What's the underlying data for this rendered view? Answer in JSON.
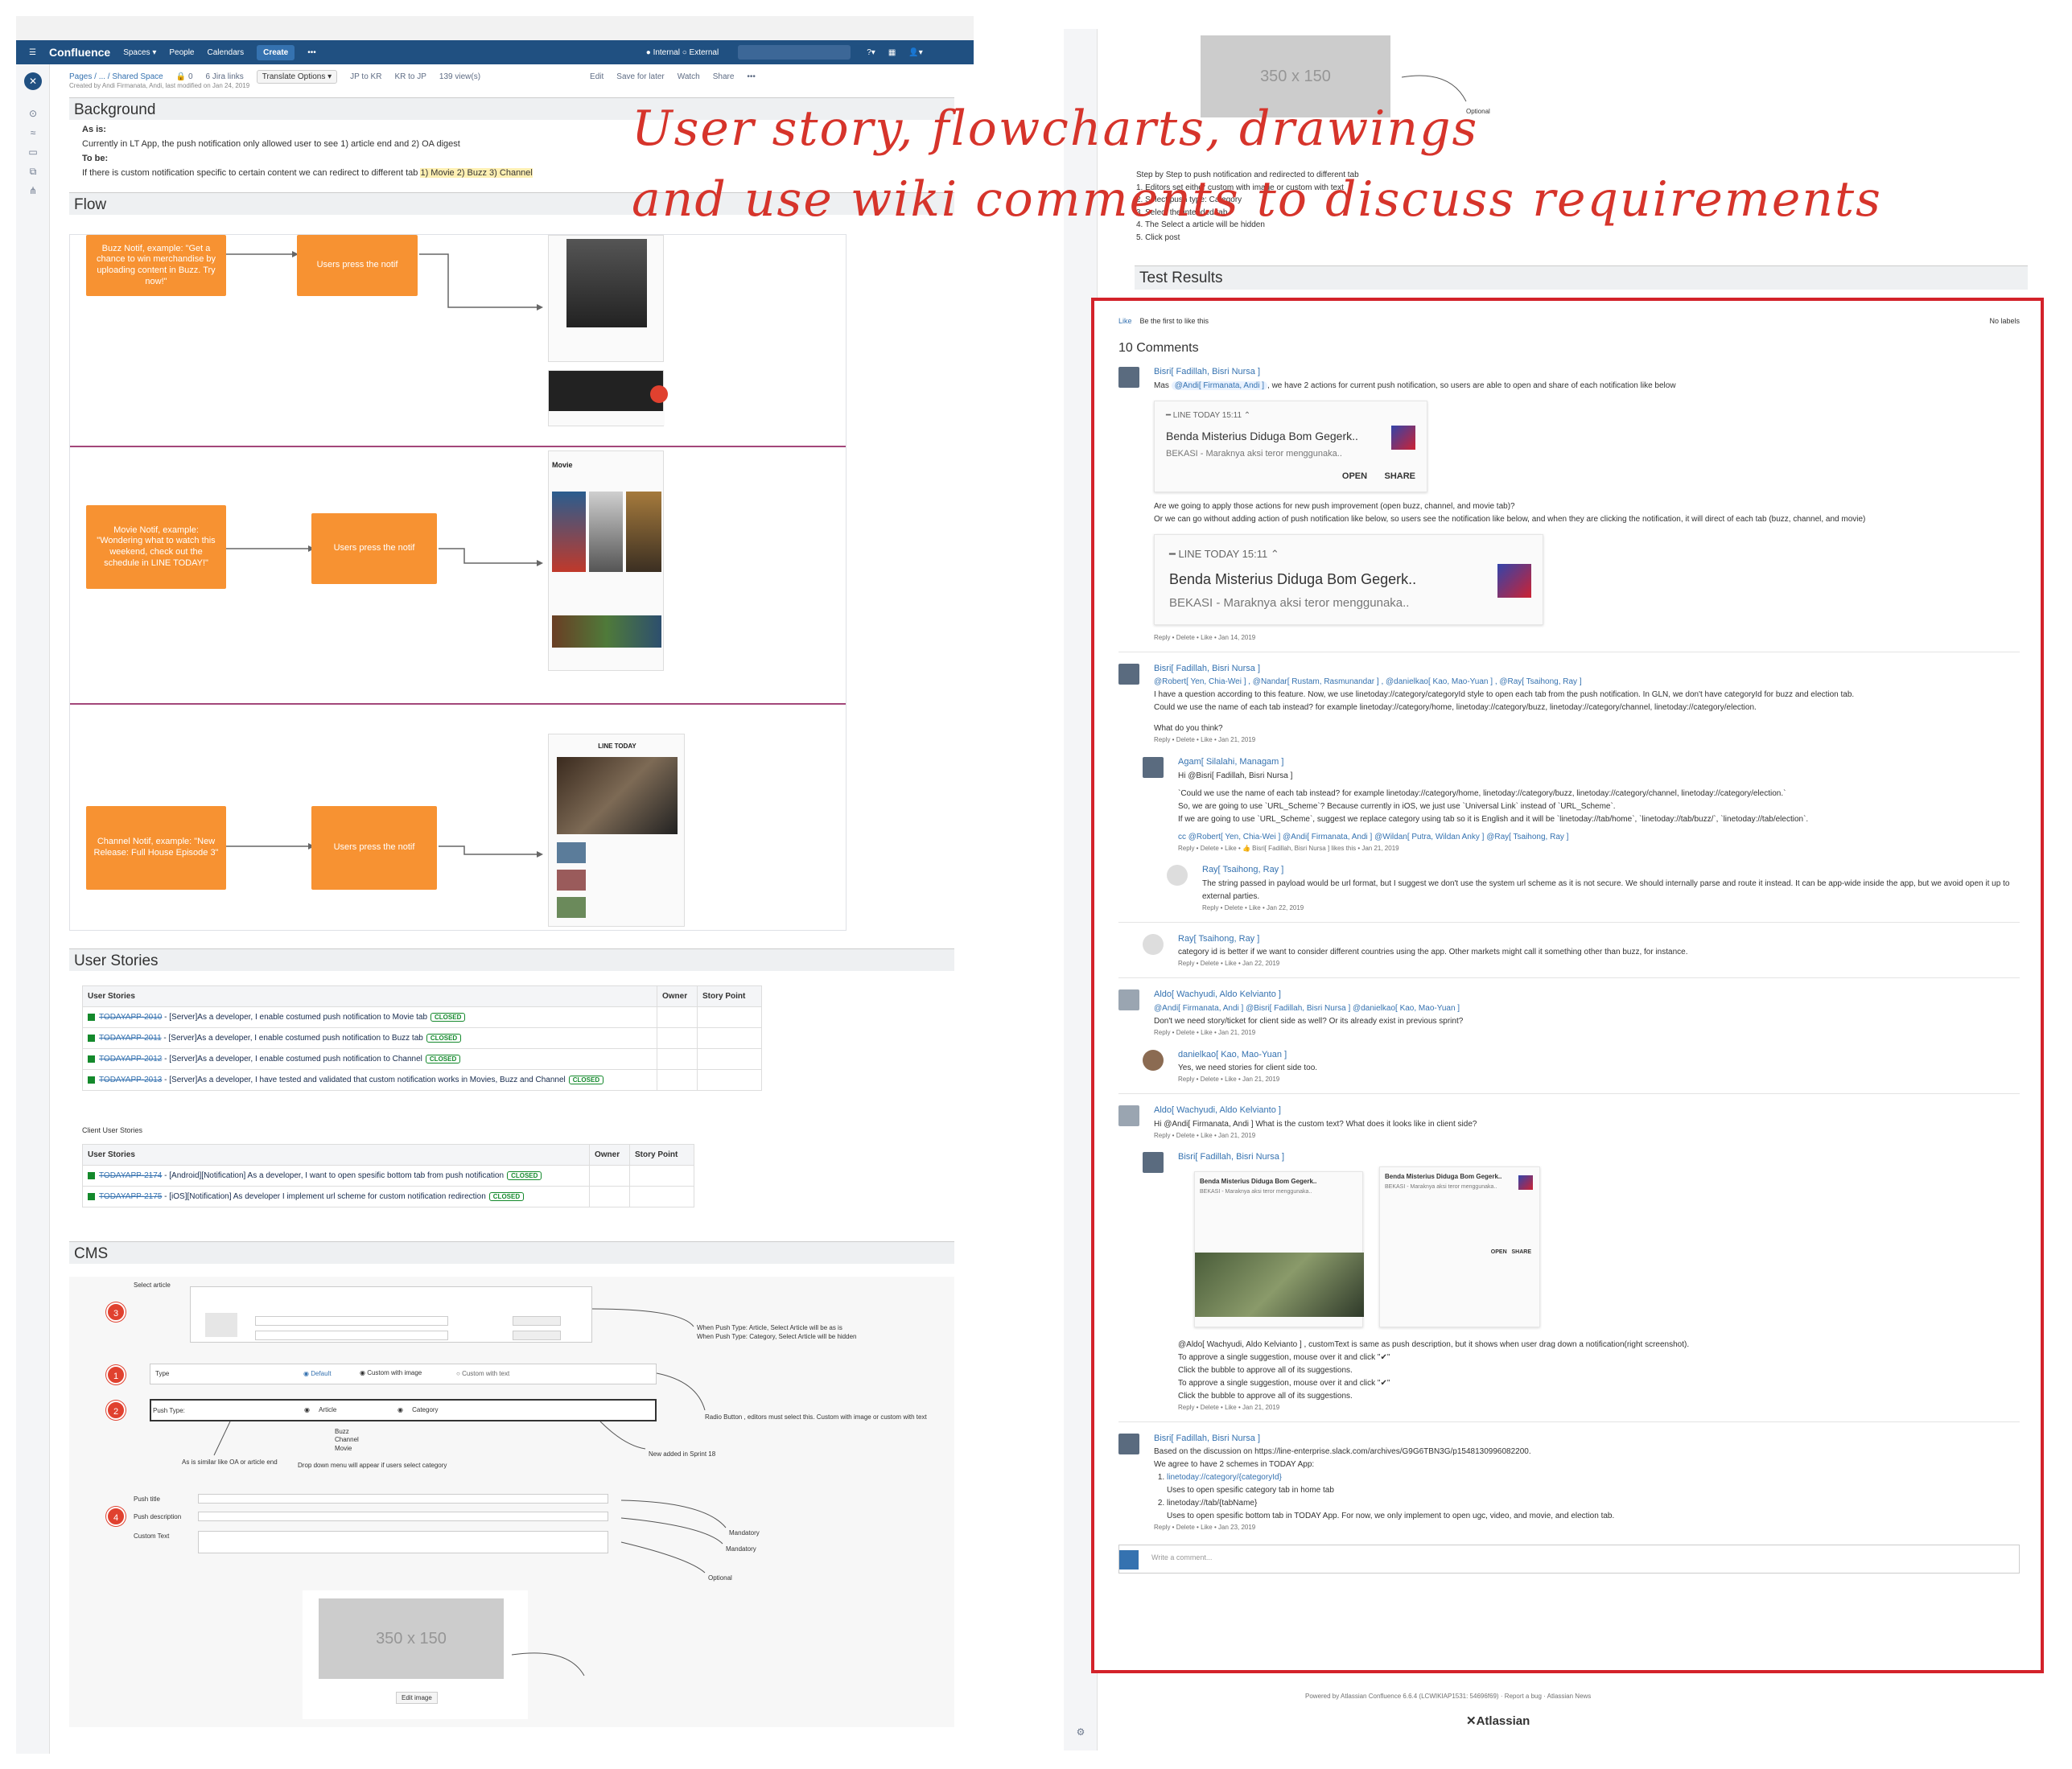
{
  "left": {
    "topbar": {
      "logo": "Confluence",
      "spaces": "Spaces ▾",
      "people": "People",
      "calendars": "Calendars",
      "create": "Create",
      "more": "•••",
      "internal_external": "● Internal  ○ External"
    },
    "breadcrumb": {
      "path": "Pages / ... / Shared Space",
      "lock": "🔒 0",
      "jira_links": "6 Jira links",
      "translate": "Translate Options ▾",
      "jp_kr": "JP to KR",
      "kr_jp": "KR to JP",
      "views": "139 view(s)",
      "edit": "Edit",
      "save_later": "Save for later",
      "watch": "Watch",
      "share": "Share",
      "more": "•••"
    },
    "byline": "Created by Andi Firmanata, Andi, last modified on Jan 24, 2019",
    "background": {
      "heading": "Background",
      "as_is_label": "As is:",
      "as_is_text": "Currently in LT App, the push notification only allowed user to see 1) article end and 2) OA digest",
      "to_be_label": "To be:",
      "to_be_text": "If there is custom notification specific to certain content we can redirect to different tab",
      "to_be_highlight": "1) Movie 2) Buzz 3) Channel"
    },
    "flow": {
      "heading": "Flow",
      "rows": [
        {
          "box_text": "Buzz Notif, example: \"Get a chance to win merchandise by uploading content in Buzz. Try now!\"",
          "press": "Users press the notif"
        },
        {
          "box_text": "Movie Notif, example: \"Wondering what to watch this weekend, check out the schedule in LINE TODAY!\"",
          "press": "Users press the notif"
        },
        {
          "box_text": "Channel Notif, example: \"New Release: Full House Episode 3\"",
          "press": "Users press the notif"
        }
      ],
      "movie_label": "Movie",
      "line_today": "LINE TODAY"
    },
    "user_stories": {
      "heading": "User Stories",
      "columns": [
        "User Stories",
        "Owner",
        "Story Point"
      ],
      "rows": [
        {
          "key": "TODAYAPP-2010",
          "text": "- [Server]As a developer, I enable costumed push notification to Movie tab",
          "status": "CLOSED"
        },
        {
          "key": "TODAYAPP-2011",
          "text": "- [Server]As a developer, I enable costumed push notification to Buzz tab",
          "status": "CLOSED"
        },
        {
          "key": "TODAYAPP-2012",
          "text": "- [Server]As a developer, I enable costumed push notification to Channel",
          "status": "CLOSED"
        },
        {
          "key": "TODAYAPP-2013",
          "text": "- [Server]As a developer, I have tested and validated that custom notification works in Movies, Buzz and Channel",
          "status": "CLOSED"
        }
      ],
      "client_title": "Client User Stories",
      "client_columns": [
        "User Stories",
        "Owner",
        "Story Point"
      ],
      "client_rows": [
        {
          "key": "TODAYAPP-2174",
          "text": "- [Android][Notification] As a developer, I want to open spesific bottom tab from push notification",
          "status": "CLOSED"
        },
        {
          "key": "TODAYAPP-2175",
          "text": "- [iOS][Notification] As developer I implement url scheme for custom notification redirection",
          "status": "CLOSED"
        }
      ]
    },
    "cms": {
      "heading": "CMS",
      "select_article": "Select article",
      "n3": "3",
      "n1": "1",
      "n2": "2",
      "n4": "4",
      "type_label": "Type",
      "type_default": "Default",
      "type_custom_image": "Custom with image",
      "type_custom_text": "Custom with text",
      "push_type": "Push Type:",
      "article": "Article",
      "category": "Category",
      "dropdown_items": "Buzz\nChannel\nMovie",
      "note_push_type": "When Push Type: Article, Select Article will be as is\nWhen Push Type: Category, Select Article will be hidden",
      "note_radio": "Radio Button , editors must select this. Custom with image or custom with text",
      "note_new": "New added in Sprint 18",
      "note_similar": "As is similar like OA or article end",
      "note_dropdown": "Drop down menu will appear if users select category",
      "push_title": "Push title",
      "push_description": "Push description",
      "custom_text": "Custom Text",
      "mandatory1": "Mandatory",
      "mandatory2": "Mandatory",
      "optional": "Optional",
      "placeholder": "350 x 150",
      "edit_image": "Edit image"
    }
  },
  "right": {
    "placeholder": "350 x 150",
    "optional": "Optional",
    "steps_title": "Step by Step to push notification and redirected to different tab",
    "steps": [
      "1. Editors set either custom with image or custom with text",
      "2. Select push type: Category",
      "3. Select the intended tab",
      "4. The Select a article will be hidden",
      "5. Click post"
    ],
    "test_results": "Test Results",
    "like": "Like",
    "be_first": "Be the first to like this",
    "no_labels": "No labels",
    "comments_title": "10 Comments",
    "comments": [
      {
        "author": "Bisri[ Fadillah, Bisri Nursa ]",
        "body": "Mas",
        "mention": "@Andi[ Firmanata, Andi ]",
        "body2": ", we have 2 actions for current push notification, so users are able to open and share of each notification like below",
        "after": "Are we going to apply those actions for new push improvement (open buzz, channel, and movie tab)?\nOr we can go without adding action of push notification like below, so users see the notification like below, and when they are clicking the notification, it will direct of each tab (buzz, channel, and movie)",
        "meta": "Reply • Delete • Like • Jan 14, 2019"
      },
      {
        "author": "Bisri[ Fadillah, Bisri Nursa ]",
        "mentions": "@Robert[ Yen, Chia-Wei ] , @Nandar[ Rustam, Rasmunandar ] , @danielkao[ Kao, Mao-Yuan ] , @Ray[ Tsaihong, Ray ]",
        "body": "I have a question according to this feature. Now, we use linetoday://category/categoryId style to open each tab from the push notification. In GLN, we don't have categoryId for buzz and election tab.\nCould we use the name of each tab instead? for example linetoday://category/home, linetoday://category/buzz, linetoday://category/channel, linetoday://category/election.",
        "body3": "What do you think?",
        "meta": "Reply • Delete • Like • Jan 21, 2019"
      },
      {
        "author": "Agam[ Silalahi, Managam ]",
        "body": "Hi @Bisri[ Fadillah, Bisri Nursa ]",
        "q": "`Could we use the name of each tab instead? for example linetoday://category/home, linetoday://category/buzz, linetoday://category/channel, linetoday://category/election.`",
        "b2": "So, we are going to use `URL_Scheme`? Because currently in iOS, we just use `Universal Link` instead of `URL_Scheme`.",
        "b3": "If we are going to use `URL_Scheme`, suggest we replace category using tab so it is English and it will be `linetoday://tab/home`, `linetoday://tab/buzz/`, `linetoday://tab/election`.",
        "cc": "cc @Robert[ Yen, Chia-Wei ] @Andi[ Firmanata, Andi ] @Wildan[ Putra, Wildan Anky ] @Ray[ Tsaihong, Ray ]",
        "meta": "Reply • Delete • Like • 👍 Bisri[ Fadillah, Bisri Nursa ] likes this • Jan 21, 2019"
      },
      {
        "author": "Ray[ Tsaihong, Ray ]",
        "body": "The string passed in payload would be url format, but I suggest we don't use the system url scheme as it is not secure. We should internally parse and route it instead. It can be app-wide inside the app, but we avoid open it up to external parties.",
        "meta": "Reply • Delete • Like • Jan 22, 2019"
      },
      {
        "author": "Ray[ Tsaihong, Ray ]",
        "body": "category id is better if we want to consider different countries using the app. Other markets might call it something other than buzz, for instance.",
        "meta": "Reply • Delete • Like • Jan 22, 2019"
      },
      {
        "author": "Aldo[ Wachyudi, Aldo Kelvianto ]",
        "mentions": "@Andi[ Firmanata, Andi ] @Bisri[ Fadillah, Bisri Nursa ] @danielkao[ Kao, Mao-Yuan ]",
        "body": "Don't we need story/ticket for client side as well? Or its already exist in previous sprint?",
        "meta": "Reply • Delete • Like • Jan 21, 2019"
      },
      {
        "author": "danielkao[ Kao, Mao-Yuan ]",
        "body": "Yes, we need stories for client side too.",
        "meta": "Reply • Delete • Like • Jan 21, 2019"
      },
      {
        "author": "Aldo[ Wachyudi, Aldo Kelvianto ]",
        "body": "Hi @Andi[ Firmanata, Andi ] What is the custom text? What does it looks like in client side?",
        "meta": "Reply • Delete • Like • Jan 21, 2019"
      },
      {
        "author": "Bisri[ Fadillah, Bisri Nursa ]",
        "body": "@Aldo[ Wachyudi, Aldo Kelvianto ] , customText is same as push description, but it shows when user drag down a notification(right screenshot).\nTo approve a single suggestion, mouse over it and click \"✔\"\nClick the bubble to approve all of its suggestions.\nTo approve a single suggestion, mouse over it and click \"✔\"\nClick the bubble to approve all of its suggestions.",
        "meta": "Reply • Delete • Like • Jan 21, 2019"
      },
      {
        "author": "Bisri[ Fadillah, Bisri Nursa ]",
        "body": "Based on the discussion on https://line-enterprise.slack.com/archives/G9G6TBN3G/p1548130996082200.\nWe agree to have 2 schemes in TODAY App:",
        "li1": "linetoday://category/{categoryId}",
        "li1b": "Uses to open spesific category tab in home tab",
        "li2": "linetoday://tab/{tabName}",
        "li2b": "Uses to open spesific bottom tab in TODAY App. For now, we only implement to open ugc, video, and movie, and election tab.",
        "meta": "Reply • Delete • Like • Jan 23, 2019"
      }
    ],
    "notif": {
      "header": "━  LINE TODAY  15:11  ⌃",
      "title": "Benda Misterius Diduga Bom Gegerk..",
      "sub": "BEKASI - Maraknya aksi teror menggunaka..",
      "open": "OPEN",
      "share": "SHARE"
    },
    "write_comment": "Write a comment...",
    "footer": "Powered by Atlassian Confluence 6.6.4 (LCWIKIAP1531: 54696f69)  ·  Report a bug  ·  Atlassian News",
    "footer_logo": "Atlassian"
  },
  "overlay": {
    "line1": "User story, flowcharts, drawings",
    "line2": "and use wiki comments to discuss requirements"
  },
  "colors": {
    "topbar": "#205081",
    "orange_box": "#f79232",
    "frame_red": "#d3222a",
    "handwriting_red": "#d6342b"
  }
}
